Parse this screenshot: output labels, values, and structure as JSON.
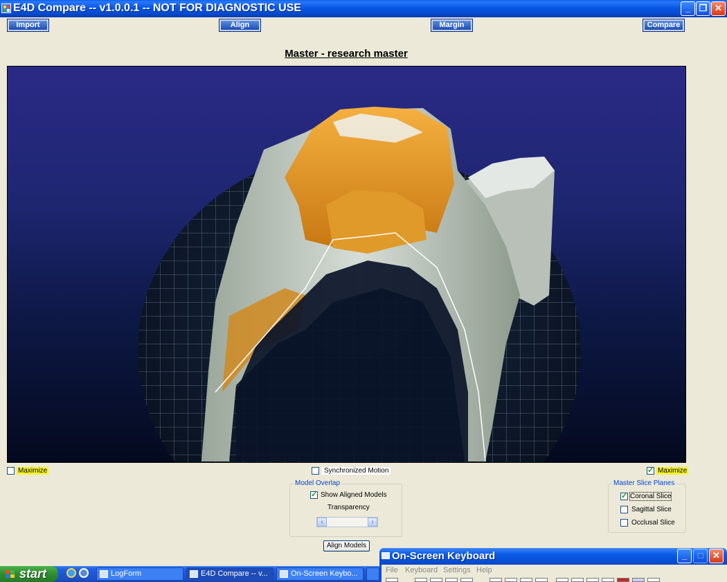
{
  "window": {
    "title": "E4D Compare -- v1.0.0.1 -- NOT FOR DIAGNOSTIC USE"
  },
  "toolbar": {
    "import_label": "Import",
    "align_label": "Align",
    "margin_label": "Margin",
    "compare_label": "Compare"
  },
  "view": {
    "title": "Master - research master"
  },
  "controls": {
    "left_maximize": {
      "label": "Maximize",
      "checked": false
    },
    "synchronized_motion": {
      "label": "Synchronized Motion",
      "checked": false
    },
    "right_maximize": {
      "label": "Maximize",
      "checked": true
    }
  },
  "model_overlap": {
    "legend": "Model Overlap",
    "show_aligned_models": {
      "label": "Show Aligned Models",
      "checked": true
    },
    "transparency_label": "Transparency"
  },
  "slice_planes": {
    "legend": "Master Slice Planes",
    "items": [
      {
        "label": "Coronal Slice",
        "checked": true
      },
      {
        "label": "Sagittal Slice",
        "checked": false
      },
      {
        "label": "Occlusal Slice",
        "checked": false
      }
    ]
  },
  "align_models_label": "Align Models",
  "osk": {
    "title": "On-Screen Keyboard",
    "menu": [
      "File",
      "Keyboard",
      "Settings",
      "Help"
    ]
  },
  "taskbar": {
    "start_label": "start",
    "items": [
      "LogForm",
      "E4D Compare -- v...",
      "On-Screen Keybo..."
    ]
  },
  "colors": {
    "title_bar": "#0a5ae8",
    "viewport_top": "#2a2a86",
    "model_orange": "#e8a020",
    "model_gray": "#c8d0c8",
    "highlight": "#f7f22c"
  }
}
